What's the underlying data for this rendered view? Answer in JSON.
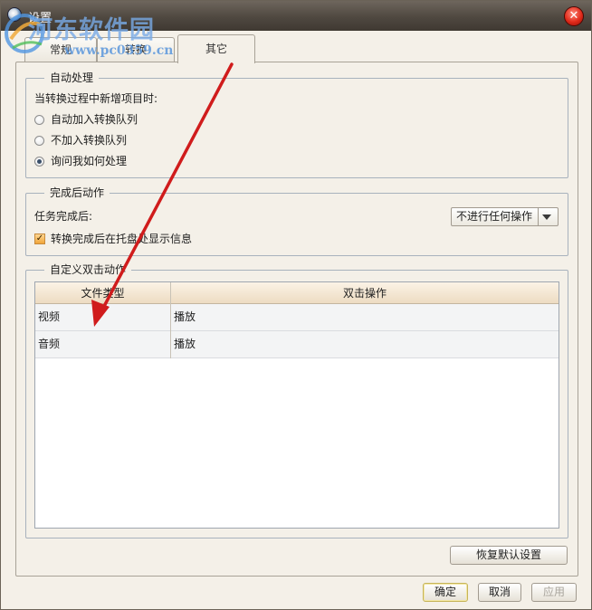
{
  "window": {
    "title": "设置",
    "close_glyph": "✕"
  },
  "watermark": {
    "site_name": "河东软件园",
    "url": "www.pc0359.cn"
  },
  "tabs": [
    {
      "label": "常规",
      "active": false
    },
    {
      "label": "转换",
      "active": false
    },
    {
      "label": "其它",
      "active": true
    }
  ],
  "auto_process": {
    "title": "自动处理",
    "prompt": "当转换过程中新增项目时:",
    "options": [
      {
        "label": "自动加入转换队列",
        "checked": false
      },
      {
        "label": "不加入转换队列",
        "checked": false
      },
      {
        "label": "询问我如何处理",
        "checked": true
      }
    ]
  },
  "after_complete": {
    "title": "完成后动作",
    "task_label": "任务完成后:",
    "action_value": "不进行任何操作",
    "tray_checkbox": {
      "label": "转换完成后在托盘处显示信息",
      "checked": true,
      "glyph": "✓"
    }
  },
  "double_click": {
    "title": "自定义双击动作",
    "columns": [
      "文件类型",
      "双击操作"
    ],
    "rows": [
      [
        "视频",
        "播放"
      ],
      [
        "音频",
        "播放"
      ]
    ]
  },
  "buttons": {
    "restore_defaults": "恢复默认设置",
    "ok": "确定",
    "cancel": "取消",
    "apply": "应用"
  },
  "colors": {
    "annotation_arrow": "#d01c1c",
    "titlebar": "#4f4840",
    "dialog_bg": "#f4f0e8"
  }
}
